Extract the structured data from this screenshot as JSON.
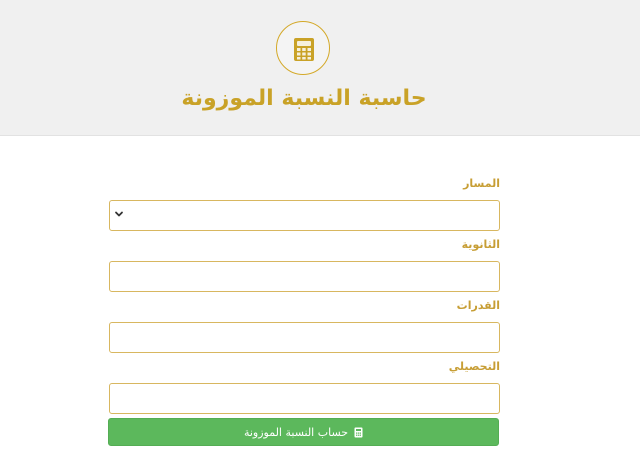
{
  "header": {
    "title": "حاسبة النسبة الموزونة",
    "accent_color": "#c9a227",
    "logo_icon": "calculator-icon"
  },
  "form": {
    "track_label": "المسار",
    "track_selected": "",
    "secondary_label": "الثانوية",
    "secondary_value": "",
    "aptitude_label": "القدرات",
    "aptitude_value": "",
    "achievement_label": "التحصيلي",
    "achievement_value": "",
    "field_border_color": "#d8b760"
  },
  "submit": {
    "label": "حساب النسبة الموزونة",
    "icon": "calculator-icon",
    "color": "#5cb85c"
  }
}
